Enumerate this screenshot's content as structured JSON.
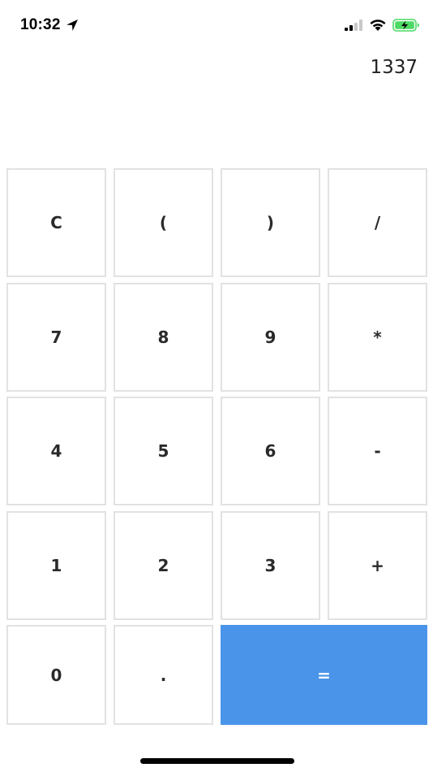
{
  "status_bar": {
    "time": "10:32",
    "icons": [
      "location-arrow-icon",
      "cellular-signal-icon",
      "wifi-icon",
      "battery-charging-icon"
    ],
    "battery_color": "#4cd964"
  },
  "display": {
    "value": "1337"
  },
  "keypad": {
    "accent_color": "#4a94ea",
    "rows": [
      [
        "C",
        "(",
        ")",
        "/"
      ],
      [
        "7",
        "8",
        "9",
        "*"
      ],
      [
        "4",
        "5",
        "6",
        "-"
      ],
      [
        "1",
        "2",
        "3",
        "+"
      ],
      [
        "0",
        ".",
        "="
      ]
    ]
  }
}
